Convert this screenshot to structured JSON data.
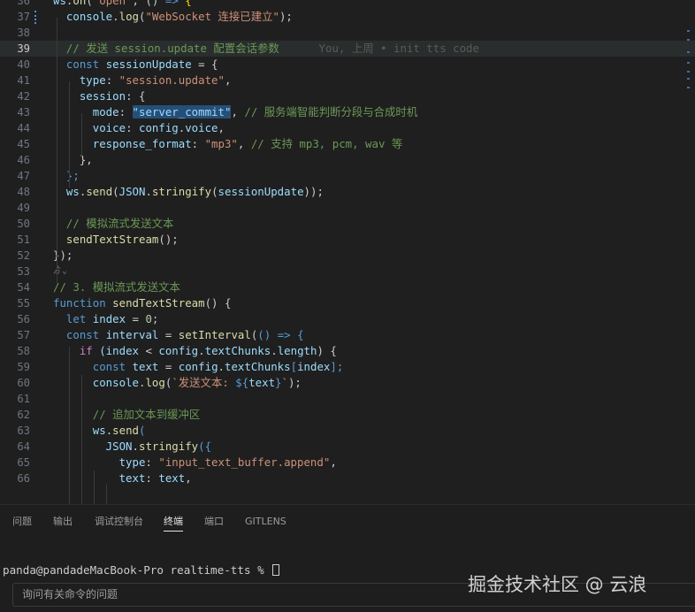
{
  "theme": {
    "bg": "#1f1f1f",
    "keyword": "#569cd6",
    "control": "#c586c0",
    "variable": "#9cdcfe",
    "function": "#dcdcaa",
    "string": "#ce9178",
    "number": "#b5cea8",
    "comment": "#6a9955",
    "punct": "#cccccc",
    "bracket": "#ffd700",
    "selection": "#264f78"
  },
  "editor": {
    "lines": [
      {
        "n": "36",
        "segs": [
          [
            "ws",
            "variable"
          ],
          [
            ".",
            "punct"
          ],
          [
            "on",
            "function"
          ],
          [
            "(",
            "punct"
          ],
          [
            "\"open\"",
            "string"
          ],
          [
            ", () ",
            "punct"
          ],
          [
            "=>",
            "keyword"
          ],
          [
            " {",
            "bracket"
          ]
        ]
      },
      {
        "n": "37",
        "segs": [
          [
            "  console",
            "variable"
          ],
          [
            ".",
            "punct"
          ],
          [
            "log",
            "function"
          ],
          [
            "(",
            "punct"
          ],
          [
            "\"WebSocket 连接已建立\"",
            "string"
          ],
          [
            ");",
            "punct"
          ]
        ],
        "mod": true
      },
      {
        "n": "38",
        "segs": []
      },
      {
        "n": "39",
        "segs": [
          [
            "  // 发送 session.update 配置会话参数",
            "comment"
          ],
          [
            "      You, 上周 • init tts code",
            "blame"
          ]
        ],
        "active": true
      },
      {
        "n": "40",
        "segs": [
          [
            "  ",
            "punct"
          ],
          [
            "const",
            "keyword"
          ],
          [
            " sessionUpdate ",
            "variable"
          ],
          [
            "= {",
            "punct"
          ]
        ]
      },
      {
        "n": "41",
        "segs": [
          [
            "    type",
            "variable"
          ],
          [
            ": ",
            "punct"
          ],
          [
            "\"session.update\"",
            "string"
          ],
          [
            ",",
            "punct"
          ]
        ]
      },
      {
        "n": "42",
        "segs": [
          [
            "    session",
            "variable"
          ],
          [
            ": {",
            "punct"
          ]
        ]
      },
      {
        "n": "43",
        "segs": [
          [
            "      mode",
            "variable"
          ],
          [
            ": ",
            "punct"
          ],
          [
            "\"server_commit\"",
            "string",
            "sel"
          ],
          [
            ", ",
            "punct"
          ],
          [
            "// 服务端智能判断分段与合成时机",
            "comment"
          ]
        ]
      },
      {
        "n": "44",
        "segs": [
          [
            "      voice",
            "variable"
          ],
          [
            ": ",
            "punct"
          ],
          [
            "config",
            "variable"
          ],
          [
            ".",
            "punct"
          ],
          [
            "voice",
            "variable"
          ],
          [
            ",",
            "punct"
          ]
        ]
      },
      {
        "n": "45",
        "segs": [
          [
            "      response_format",
            "variable"
          ],
          [
            ": ",
            "punct"
          ],
          [
            "\"mp3\"",
            "string"
          ],
          [
            ", ",
            "punct"
          ],
          [
            "// 支持 mp3, pcm, wav 等",
            "comment"
          ]
        ]
      },
      {
        "n": "46",
        "segs": [
          [
            "    },",
            "punct"
          ]
        ]
      },
      {
        "n": "47",
        "segs": [
          [
            "  };",
            "keyword"
          ]
        ]
      },
      {
        "n": "48",
        "segs": [
          [
            "  ws",
            "variable"
          ],
          [
            ".",
            "punct"
          ],
          [
            "send",
            "function"
          ],
          [
            "(",
            "punct"
          ],
          [
            "JSON",
            "variable"
          ],
          [
            ".",
            "punct"
          ],
          [
            "stringify",
            "function"
          ],
          [
            "(",
            "punct"
          ],
          [
            "sessionUpdate",
            "variable"
          ],
          [
            "));",
            "punct"
          ]
        ]
      },
      {
        "n": "49",
        "segs": []
      },
      {
        "n": "50",
        "segs": [
          [
            "  // 模拟流式发送文本",
            "comment"
          ]
        ]
      },
      {
        "n": "51",
        "segs": [
          [
            "  ",
            "punct"
          ],
          [
            "sendTextStream",
            "function"
          ],
          [
            "();",
            "punct"
          ]
        ]
      },
      {
        "n": "52",
        "segs": [
          [
            "});",
            "punct"
          ]
        ]
      },
      {
        "n": "53",
        "segs": [],
        "fold": "ゟ⌄"
      },
      {
        "n": "54",
        "segs": [
          [
            "// 3. 模拟流式发送文本",
            "comment"
          ]
        ]
      },
      {
        "n": "55",
        "segs": [
          [
            "function",
            "keyword"
          ],
          [
            " ",
            "punct"
          ],
          [
            "sendTextStream",
            "function"
          ],
          [
            "() {",
            "punct"
          ]
        ]
      },
      {
        "n": "56",
        "segs": [
          [
            "  ",
            "punct"
          ],
          [
            "let",
            "keyword"
          ],
          [
            " index ",
            "variable"
          ],
          [
            "= ",
            "punct"
          ],
          [
            "0",
            "number"
          ],
          [
            ";",
            "punct"
          ]
        ]
      },
      {
        "n": "57",
        "segs": [
          [
            "  ",
            "punct"
          ],
          [
            "const",
            "keyword"
          ],
          [
            " interval ",
            "variable"
          ],
          [
            "= ",
            "punct"
          ],
          [
            "setInterval",
            "function"
          ],
          [
            "(",
            "punct"
          ],
          [
            "() ",
            "keyword"
          ],
          [
            "=>",
            "keyword"
          ],
          [
            " {",
            "keyword"
          ]
        ]
      },
      {
        "n": "58",
        "segs": [
          [
            "    ",
            "punct"
          ],
          [
            "if",
            "control"
          ],
          [
            " (index ",
            "variable"
          ],
          [
            "< ",
            "punct"
          ],
          [
            "config",
            "variable"
          ],
          [
            ".",
            "punct"
          ],
          [
            "textChunks",
            "variable"
          ],
          [
            ".",
            "punct"
          ],
          [
            "length",
            "variable"
          ],
          [
            ") {",
            "punct"
          ]
        ]
      },
      {
        "n": "59",
        "segs": [
          [
            "      ",
            "punct"
          ],
          [
            "const",
            "keyword"
          ],
          [
            " text ",
            "variable"
          ],
          [
            "= ",
            "punct"
          ],
          [
            "config",
            "variable"
          ],
          [
            ".",
            "punct"
          ],
          [
            "textChunks",
            "variable"
          ],
          [
            "[",
            "keyword"
          ],
          [
            "index",
            "variable"
          ],
          [
            "];",
            "keyword"
          ]
        ]
      },
      {
        "n": "60",
        "segs": [
          [
            "      console",
            "variable"
          ],
          [
            ".",
            "punct"
          ],
          [
            "log",
            "function"
          ],
          [
            "(",
            "punct"
          ],
          [
            "`发送文本: ",
            "string"
          ],
          [
            "${",
            "keyword"
          ],
          [
            "text",
            "variable"
          ],
          [
            "}",
            "keyword"
          ],
          [
            "`",
            "string"
          ],
          [
            ");",
            "punct"
          ]
        ]
      },
      {
        "n": "61",
        "segs": []
      },
      {
        "n": "62",
        "segs": [
          [
            "      // 追加文本到缓冲区",
            "comment"
          ]
        ]
      },
      {
        "n": "63",
        "segs": [
          [
            "      ws",
            "variable"
          ],
          [
            ".",
            "punct"
          ],
          [
            "send",
            "function"
          ],
          [
            "(",
            "keyword"
          ]
        ]
      },
      {
        "n": "64",
        "segs": [
          [
            "        JSON",
            "variable"
          ],
          [
            ".",
            "punct"
          ],
          [
            "stringify",
            "function"
          ],
          [
            "({",
            "keyword"
          ]
        ]
      },
      {
        "n": "65",
        "segs": [
          [
            "          type",
            "variable"
          ],
          [
            ": ",
            "punct"
          ],
          [
            "\"input_text_buffer.append\"",
            "string"
          ],
          [
            ",",
            "punct"
          ]
        ]
      },
      {
        "n": "66",
        "segs": [
          [
            "          text",
            "variable"
          ],
          [
            ": ",
            "punct"
          ],
          [
            "text",
            "variable"
          ],
          [
            ",",
            "punct"
          ]
        ]
      }
    ]
  },
  "panel": {
    "tabs": [
      {
        "label": "问题",
        "active": false
      },
      {
        "label": "输出",
        "active": false
      },
      {
        "label": "调试控制台",
        "active": false
      },
      {
        "label": "终端",
        "active": true
      },
      {
        "label": "端口",
        "active": false
      },
      {
        "label": "GITLENS",
        "active": false
      }
    ],
    "prompt": "panda@pandadeMacBook-Pro realtime-tts % ",
    "ask_placeholder": "询问有关命令的问题"
  },
  "watermark": "掘金技术社区 @ 云浪"
}
